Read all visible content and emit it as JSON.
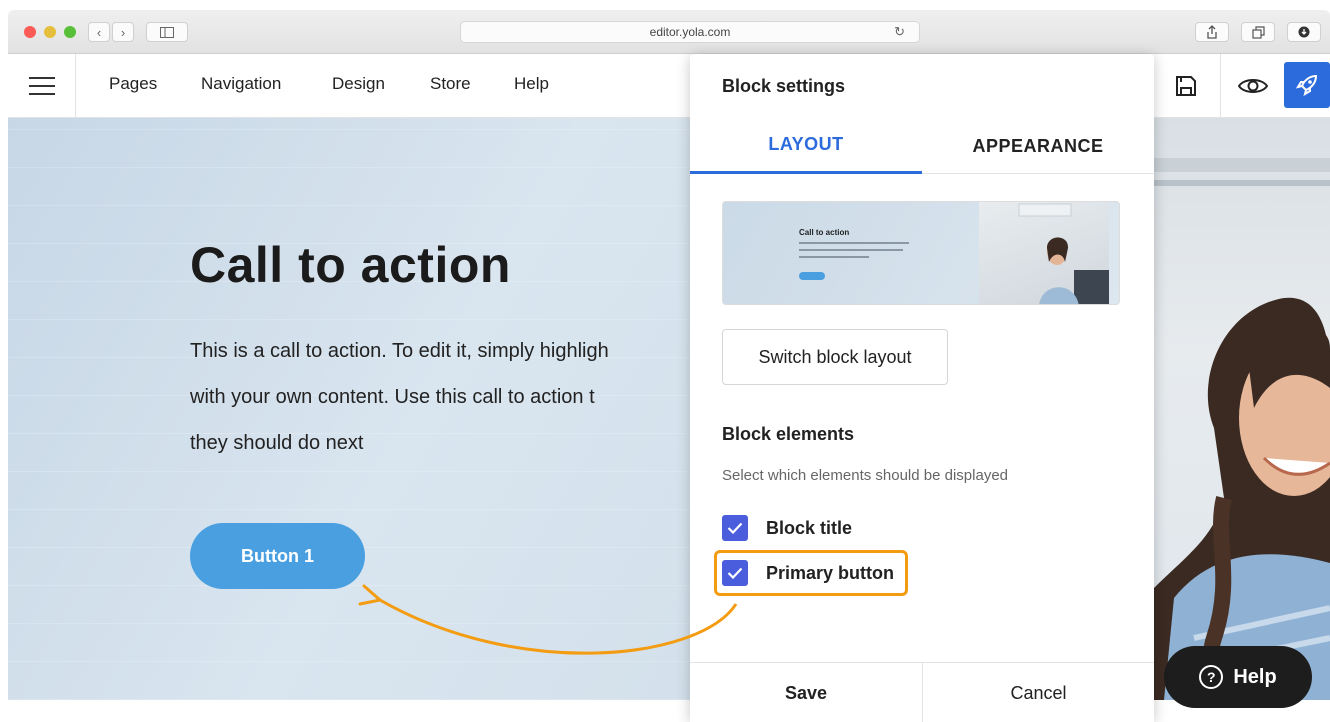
{
  "browser": {
    "url": "editor.yola.com",
    "back_glyph": "‹",
    "forward_glyph": "›"
  },
  "toolbar": {
    "nav": [
      "Pages",
      "Navigation",
      "Design",
      "Store",
      "Help"
    ]
  },
  "hero": {
    "title": "Call to action",
    "text_lines": [
      "This is a call to action. To edit it, simply highligh",
      "with your own content. Use this call to action t",
      "they should do next"
    ],
    "button_label": "Button 1"
  },
  "panel": {
    "title": "Block settings",
    "tabs": {
      "layout": "LAYOUT",
      "appearance": "APPEARANCE"
    },
    "preview_title": "Call to action",
    "preview_button": "Button 1",
    "switch_label": "Switch block layout",
    "elements_title": "Block elements",
    "elements_sub": "Select which elements should be displayed",
    "elements": [
      {
        "label": "Block title",
        "checked": true
      },
      {
        "label": "Primary button",
        "checked": true
      }
    ],
    "save_label": "Save",
    "cancel_label": "Cancel"
  },
  "help_button": {
    "label": "Help",
    "glyph": "?"
  },
  "colors": {
    "accent": "#2b6bdc",
    "checkbox": "#4a5ddc",
    "highlight": "#f39c12",
    "hero_button": "#4a9fe0"
  },
  "icons": [
    "hamburger-icon",
    "save-icon",
    "eye-icon",
    "rocket-icon",
    "share-icon",
    "tabs-icon",
    "download-icon",
    "sidebar-icon",
    "reload-icon",
    "check-icon",
    "question-icon"
  ]
}
